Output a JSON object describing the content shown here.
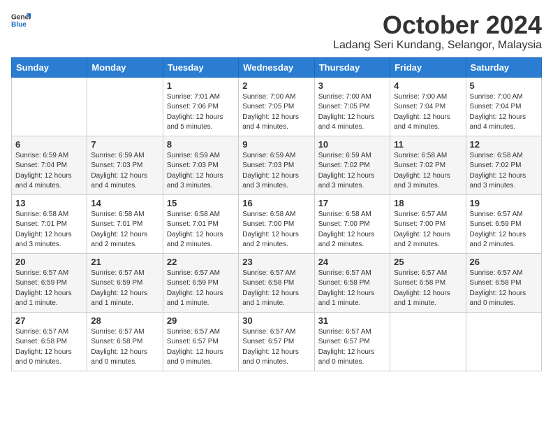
{
  "logo": {
    "general": "General",
    "blue": "Blue"
  },
  "title": "October 2024",
  "location": "Ladang Seri Kundang, Selangor, Malaysia",
  "headers": [
    "Sunday",
    "Monday",
    "Tuesday",
    "Wednesday",
    "Thursday",
    "Friday",
    "Saturday"
  ],
  "weeks": [
    [
      {
        "day": "",
        "info": ""
      },
      {
        "day": "",
        "info": ""
      },
      {
        "day": "1",
        "info": "Sunrise: 7:01 AM\nSunset: 7:06 PM\nDaylight: 12 hours\nand 5 minutes."
      },
      {
        "day": "2",
        "info": "Sunrise: 7:00 AM\nSunset: 7:05 PM\nDaylight: 12 hours\nand 4 minutes."
      },
      {
        "day": "3",
        "info": "Sunrise: 7:00 AM\nSunset: 7:05 PM\nDaylight: 12 hours\nand 4 minutes."
      },
      {
        "day": "4",
        "info": "Sunrise: 7:00 AM\nSunset: 7:04 PM\nDaylight: 12 hours\nand 4 minutes."
      },
      {
        "day": "5",
        "info": "Sunrise: 7:00 AM\nSunset: 7:04 PM\nDaylight: 12 hours\nand 4 minutes."
      }
    ],
    [
      {
        "day": "6",
        "info": "Sunrise: 6:59 AM\nSunset: 7:04 PM\nDaylight: 12 hours\nand 4 minutes."
      },
      {
        "day": "7",
        "info": "Sunrise: 6:59 AM\nSunset: 7:03 PM\nDaylight: 12 hours\nand 4 minutes."
      },
      {
        "day": "8",
        "info": "Sunrise: 6:59 AM\nSunset: 7:03 PM\nDaylight: 12 hours\nand 3 minutes."
      },
      {
        "day": "9",
        "info": "Sunrise: 6:59 AM\nSunset: 7:03 PM\nDaylight: 12 hours\nand 3 minutes."
      },
      {
        "day": "10",
        "info": "Sunrise: 6:59 AM\nSunset: 7:02 PM\nDaylight: 12 hours\nand 3 minutes."
      },
      {
        "day": "11",
        "info": "Sunrise: 6:58 AM\nSunset: 7:02 PM\nDaylight: 12 hours\nand 3 minutes."
      },
      {
        "day": "12",
        "info": "Sunrise: 6:58 AM\nSunset: 7:02 PM\nDaylight: 12 hours\nand 3 minutes."
      }
    ],
    [
      {
        "day": "13",
        "info": "Sunrise: 6:58 AM\nSunset: 7:01 PM\nDaylight: 12 hours\nand 3 minutes."
      },
      {
        "day": "14",
        "info": "Sunrise: 6:58 AM\nSunset: 7:01 PM\nDaylight: 12 hours\nand 2 minutes."
      },
      {
        "day": "15",
        "info": "Sunrise: 6:58 AM\nSunset: 7:01 PM\nDaylight: 12 hours\nand 2 minutes."
      },
      {
        "day": "16",
        "info": "Sunrise: 6:58 AM\nSunset: 7:00 PM\nDaylight: 12 hours\nand 2 minutes."
      },
      {
        "day": "17",
        "info": "Sunrise: 6:58 AM\nSunset: 7:00 PM\nDaylight: 12 hours\nand 2 minutes."
      },
      {
        "day": "18",
        "info": "Sunrise: 6:57 AM\nSunset: 7:00 PM\nDaylight: 12 hours\nand 2 minutes."
      },
      {
        "day": "19",
        "info": "Sunrise: 6:57 AM\nSunset: 6:59 PM\nDaylight: 12 hours\nand 2 minutes."
      }
    ],
    [
      {
        "day": "20",
        "info": "Sunrise: 6:57 AM\nSunset: 6:59 PM\nDaylight: 12 hours\nand 1 minute."
      },
      {
        "day": "21",
        "info": "Sunrise: 6:57 AM\nSunset: 6:59 PM\nDaylight: 12 hours\nand 1 minute."
      },
      {
        "day": "22",
        "info": "Sunrise: 6:57 AM\nSunset: 6:59 PM\nDaylight: 12 hours\nand 1 minute."
      },
      {
        "day": "23",
        "info": "Sunrise: 6:57 AM\nSunset: 6:58 PM\nDaylight: 12 hours\nand 1 minute."
      },
      {
        "day": "24",
        "info": "Sunrise: 6:57 AM\nSunset: 6:58 PM\nDaylight: 12 hours\nand 1 minute."
      },
      {
        "day": "25",
        "info": "Sunrise: 6:57 AM\nSunset: 6:58 PM\nDaylight: 12 hours\nand 1 minute."
      },
      {
        "day": "26",
        "info": "Sunrise: 6:57 AM\nSunset: 6:58 PM\nDaylight: 12 hours\nand 0 minutes."
      }
    ],
    [
      {
        "day": "27",
        "info": "Sunrise: 6:57 AM\nSunset: 6:58 PM\nDaylight: 12 hours\nand 0 minutes."
      },
      {
        "day": "28",
        "info": "Sunrise: 6:57 AM\nSunset: 6:58 PM\nDaylight: 12 hours\nand 0 minutes."
      },
      {
        "day": "29",
        "info": "Sunrise: 6:57 AM\nSunset: 6:57 PM\nDaylight: 12 hours\nand 0 minutes."
      },
      {
        "day": "30",
        "info": "Sunrise: 6:57 AM\nSunset: 6:57 PM\nDaylight: 12 hours\nand 0 minutes."
      },
      {
        "day": "31",
        "info": "Sunrise: 6:57 AM\nSunset: 6:57 PM\nDaylight: 12 hours\nand 0 minutes."
      },
      {
        "day": "",
        "info": ""
      },
      {
        "day": "",
        "info": ""
      }
    ]
  ]
}
